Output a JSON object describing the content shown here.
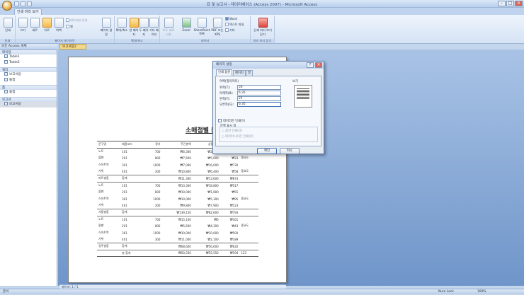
{
  "window": {
    "title": "표 및 보고서 - 데이터베이스 (Access 2007) - Microsoft Access"
  },
  "ribbon": {
    "tabs": [
      "인쇄 미리 보기"
    ],
    "groups": [
      {
        "label": "인쇄"
      },
      {
        "label": "페이지 레이아웃"
      },
      {
        "label": "확대/축소"
      },
      {
        "label": "데이터"
      },
      {
        "label": "미리 보기 닫기"
      }
    ],
    "buttons": {
      "print": "인쇄",
      "size": "크기",
      "portrait": "세로",
      "landscape": "가로",
      "margins": "여백",
      "print_data_only": "데이터만 인쇄",
      "columns": "열",
      "page_setup": "페이지 설정",
      "zoom": "확대/축소",
      "one_page": "한 페이지",
      "two_pages": "두 페이지",
      "more_pages": "기타 페이지",
      "refresh_all": "모두 새로 고침",
      "excel": "Excel",
      "sharepoint": "SharePoint 목록",
      "pdf_xps": "PDF 또는 XPS",
      "word": "Word",
      "text_file": "텍스트 파일",
      "more": "기타",
      "close_preview": "인쇄 미리 보기 닫기"
    }
  },
  "nav": {
    "header": "모든 Access 개체",
    "sections": [
      {
        "title": "테이블",
        "items": [
          "Table1",
          "Table2"
        ]
      },
      {
        "title": "쿼리",
        "items": [
          "보고서용",
          "통합"
        ]
      },
      {
        "title": "폼",
        "items": [
          "통합"
        ]
      },
      {
        "title": "보고서",
        "items": [
          "보고서용"
        ]
      }
    ]
  },
  "document": {
    "tab": "보고서용2"
  },
  "report": {
    "title": "소매점별 문구 판매 현황",
    "columns": [
      "문구명",
      "제품코드",
      "정가",
      "주간총액",
      "상품총액",
      "",
      "비고"
    ],
    "groups": [
      {
        "rows": [
          [
            "노트",
            "101",
            "700",
            "₩6,300",
            "₩2,100",
            "₩3",
            ""
          ],
          [
            "볼펜",
            "201",
            "800",
            "₩7,600",
            "₩5,000",
            "₩23",
            "중요도"
          ],
          [
            "스마트북",
            "301",
            "1000",
            "₩7,000",
            "₩16,000",
            "₩730",
            ""
          ],
          [
            "가위",
            "401",
            "300",
            "₩10,800",
            "₩6,400",
            "₩58",
            "중요도"
          ]
        ],
        "subtotal": [
          "마트총합",
          "합계",
          "",
          "₩11,300",
          "₩13,600",
          "₩874",
          ""
        ]
      },
      {
        "rows": [
          [
            "노트",
            "101",
            "700",
            "₩13,300",
            "₩18,800",
            "₩517",
            ""
          ],
          [
            "볼펜",
            "201",
            "800",
            "₩10,000",
            "₩1,800",
            "₩55",
            ""
          ],
          [
            "스마트북",
            "301",
            "1000",
            "₩10,000",
            "₩5,300",
            "₩95",
            "중요도"
          ],
          [
            "가위",
            "401",
            "300",
            "₩9,800",
            "₩7,900",
            "₩123",
            ""
          ]
        ],
        "subtotal": [
          "서울총합",
          "합계",
          "",
          "₩139,150",
          "₩82,600",
          "₩793",
          ""
        ]
      },
      {
        "rows": [
          [
            "노트",
            "101",
            "700",
            "₩15,100",
            "₩0",
            "₩161",
            ""
          ],
          [
            "볼펜",
            "201",
            "800",
            "₩5,600",
            "₩4,300",
            "₩43",
            "중요도"
          ],
          [
            "스마트북",
            "301",
            "1000",
            "₩10,000",
            "₩10,000",
            "₩500",
            ""
          ],
          [
            "가위",
            "401",
            "300",
            "₩11,000",
            "₩2,100",
            "₩189",
            ""
          ]
        ],
        "subtotal": [
          "경주총합",
          "합계",
          "",
          "₩68,600",
          "₩56,600",
          "₩620",
          ""
        ]
      }
    ],
    "grand_total": [
      "",
      "총 합계",
      "",
      "₩50,330",
      "₩55,550",
      "₩194",
      "123"
    ]
  },
  "dialog": {
    "title": "페이지 설정",
    "tabs": [
      "인쇄 옵션",
      "페이지",
      "열"
    ],
    "margins_label": "여백(밀리미터)",
    "fields": [
      {
        "label": "위쪽(T):",
        "value": "50"
      },
      {
        "label": "아래쪽(B):",
        "value": "6.35"
      },
      {
        "label": "왼쪽(F):",
        "value": "25"
      },
      {
        "label": "오른쪽(G):",
        "value": "6.35"
      }
    ],
    "preview_label": "보기",
    "print_data_only": "데이터만 인쇄(Y)",
    "split_form": "분할 표시 폼",
    "form_only": "폼만 인쇄(O)",
    "datasheet_only": "데이터시트만 인쇄(D)",
    "ok": "확인",
    "cancel": "취소"
  },
  "status": {
    "left": "준비",
    "num_lock": "Num Lock",
    "zoom": "100%",
    "pager": "페이지: 1 / 1"
  }
}
